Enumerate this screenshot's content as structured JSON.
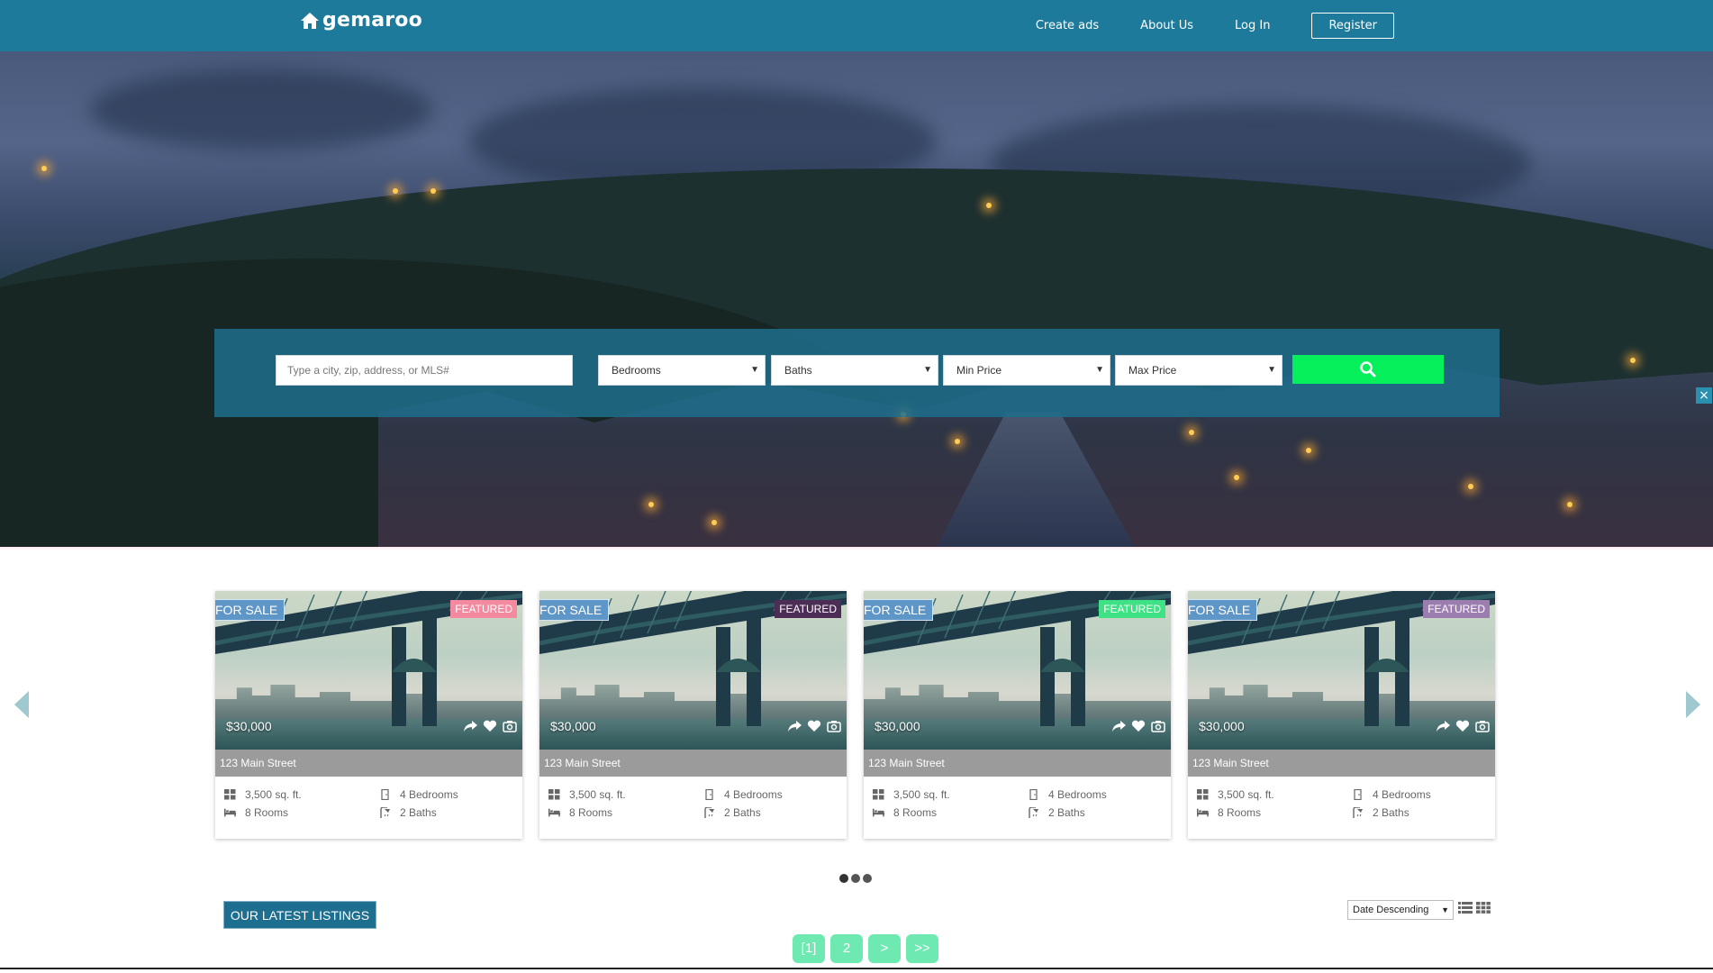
{
  "brand": {
    "name": "gemaroo",
    "logo_icon": "home-icon"
  },
  "nav": {
    "links": [
      "Create ads",
      "About Us",
      "Log In"
    ],
    "register_label": "Register"
  },
  "search": {
    "placeholder": "Type a city, zip, address, or MLS#",
    "selects": [
      "Bedrooms",
      "Baths",
      "Min Price",
      "Max Price"
    ],
    "button_icon": "search-icon",
    "button_color": "#05f05a"
  },
  "listings_carousel": {
    "cards": [
      {
        "status": "FOR SALE",
        "featured": "FEATURED",
        "featured_color": "#f48aa0",
        "price": "$30,000",
        "address": "123 Main Street",
        "sqft": "3,500 sq. ft.",
        "bedrooms": "4 Bedrooms",
        "rooms": "8 Rooms",
        "baths": "2 Baths"
      },
      {
        "status": "FOR SALE",
        "featured": "FEATURED",
        "featured_color": "#4b2d55",
        "price": "$30,000",
        "address": "123 Main Street",
        "sqft": "3,500 sq. ft.",
        "bedrooms": "4 Bedrooms",
        "rooms": "8 Rooms",
        "baths": "2 Baths"
      },
      {
        "status": "FOR SALE",
        "featured": "FEATURED",
        "featured_color": "#3ee184",
        "price": "$30,000",
        "address": "123 Main Street",
        "sqft": "3,500 sq. ft.",
        "bedrooms": "4 Bedrooms",
        "rooms": "8 Rooms",
        "baths": "2 Baths"
      },
      {
        "status": "FOR SALE",
        "featured": "FEATURED",
        "featured_color": "#9c7db0",
        "price": "$30,000",
        "address": "123 Main Street",
        "sqft": "3,500 sq. ft.",
        "bedrooms": "4 Bedrooms",
        "rooms": "8 Rooms",
        "baths": "2 Baths"
      }
    ],
    "dots": 3
  },
  "latest": {
    "title": "OUR LATEST LISTINGS",
    "sort": "Date Descending"
  },
  "pagination": [
    "[1]",
    "2",
    ">",
    ">>"
  ],
  "colors": {
    "nav": "#1e7a9a",
    "sale_badge": "#5e96c8",
    "pager": "#6ee9b2"
  }
}
